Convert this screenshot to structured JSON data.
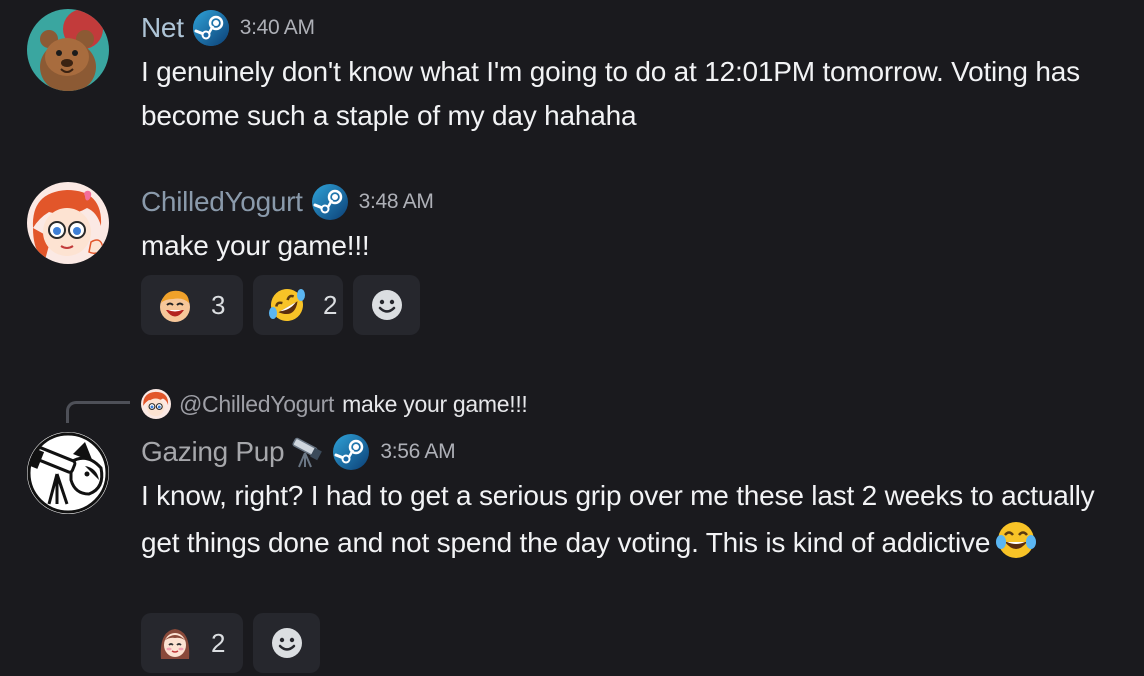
{
  "messages": [
    {
      "username": "Net",
      "username_color": "#aec4d6",
      "timestamp": "3:40 AM",
      "avatar": "bear-avatar",
      "text": "I genuinely don't know what I'm going to do at 12:01PM tomorrow. Voting has become such a staple of my day hahaha"
    },
    {
      "username": "ChilledYogurt",
      "username_color": "#8a9aab",
      "timestamp": "3:48 AM",
      "avatar": "orange-hair-girl-avatar",
      "text": "make your game!!!",
      "reactions": [
        {
          "emoji": "laughing-kid-emoji",
          "count": "3"
        },
        {
          "emoji": "rolling-on-floor-laughing-emoji",
          "count": "2"
        }
      ]
    },
    {
      "reply_to": {
        "mention": "@ChilledYogurt",
        "text": "make your game!!!"
      },
      "username": "Gazing Pup",
      "username_color": "#a6a7ab",
      "timestamp": "3:56 AM",
      "avatar": "dog-telescope-avatar",
      "text": "I know, right? I had to get a serious grip over me these last 2 weeks to actually get things done and not spend the day voting. This is kind of addictive",
      "inline_emoji": "face-with-tears-of-joy-emoji",
      "name_emoji": "telescope-emoji",
      "reactions": [
        {
          "emoji": "anime-girl-emoji",
          "count": "2"
        }
      ]
    }
  ],
  "colors": {
    "background": "#1a1a1e",
    "reaction_bg": "#26272d",
    "text": "#f2f3f5",
    "muted": "#aeb0b7"
  }
}
